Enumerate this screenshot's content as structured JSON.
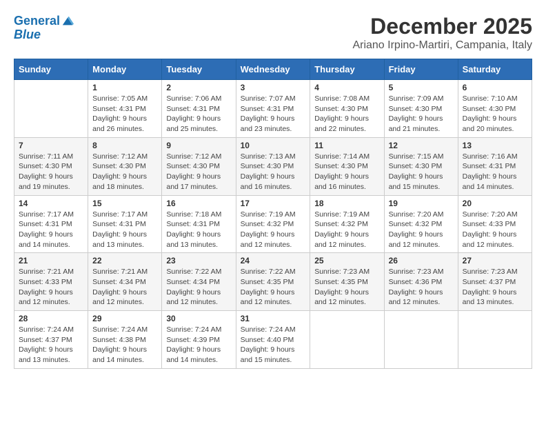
{
  "logo": {
    "line1": "General",
    "line2": "Blue"
  },
  "title": "December 2025",
  "location": "Ariano Irpino-Martiri, Campania, Italy",
  "days_of_week": [
    "Sunday",
    "Monday",
    "Tuesday",
    "Wednesday",
    "Thursday",
    "Friday",
    "Saturday"
  ],
  "weeks": [
    [
      {
        "day": "",
        "text": ""
      },
      {
        "day": "1",
        "text": "Sunrise: 7:05 AM\nSunset: 4:31 PM\nDaylight: 9 hours\nand 26 minutes."
      },
      {
        "day": "2",
        "text": "Sunrise: 7:06 AM\nSunset: 4:31 PM\nDaylight: 9 hours\nand 25 minutes."
      },
      {
        "day": "3",
        "text": "Sunrise: 7:07 AM\nSunset: 4:31 PM\nDaylight: 9 hours\nand 23 minutes."
      },
      {
        "day": "4",
        "text": "Sunrise: 7:08 AM\nSunset: 4:30 PM\nDaylight: 9 hours\nand 22 minutes."
      },
      {
        "day": "5",
        "text": "Sunrise: 7:09 AM\nSunset: 4:30 PM\nDaylight: 9 hours\nand 21 minutes."
      },
      {
        "day": "6",
        "text": "Sunrise: 7:10 AM\nSunset: 4:30 PM\nDaylight: 9 hours\nand 20 minutes."
      }
    ],
    [
      {
        "day": "7",
        "text": "Sunrise: 7:11 AM\nSunset: 4:30 PM\nDaylight: 9 hours\nand 19 minutes."
      },
      {
        "day": "8",
        "text": "Sunrise: 7:12 AM\nSunset: 4:30 PM\nDaylight: 9 hours\nand 18 minutes."
      },
      {
        "day": "9",
        "text": "Sunrise: 7:12 AM\nSunset: 4:30 PM\nDaylight: 9 hours\nand 17 minutes."
      },
      {
        "day": "10",
        "text": "Sunrise: 7:13 AM\nSunset: 4:30 PM\nDaylight: 9 hours\nand 16 minutes."
      },
      {
        "day": "11",
        "text": "Sunrise: 7:14 AM\nSunset: 4:30 PM\nDaylight: 9 hours\nand 16 minutes."
      },
      {
        "day": "12",
        "text": "Sunrise: 7:15 AM\nSunset: 4:30 PM\nDaylight: 9 hours\nand 15 minutes."
      },
      {
        "day": "13",
        "text": "Sunrise: 7:16 AM\nSunset: 4:31 PM\nDaylight: 9 hours\nand 14 minutes."
      }
    ],
    [
      {
        "day": "14",
        "text": "Sunrise: 7:17 AM\nSunset: 4:31 PM\nDaylight: 9 hours\nand 14 minutes."
      },
      {
        "day": "15",
        "text": "Sunrise: 7:17 AM\nSunset: 4:31 PM\nDaylight: 9 hours\nand 13 minutes."
      },
      {
        "day": "16",
        "text": "Sunrise: 7:18 AM\nSunset: 4:31 PM\nDaylight: 9 hours\nand 13 minutes."
      },
      {
        "day": "17",
        "text": "Sunrise: 7:19 AM\nSunset: 4:32 PM\nDaylight: 9 hours\nand 12 minutes."
      },
      {
        "day": "18",
        "text": "Sunrise: 7:19 AM\nSunset: 4:32 PM\nDaylight: 9 hours\nand 12 minutes."
      },
      {
        "day": "19",
        "text": "Sunrise: 7:20 AM\nSunset: 4:32 PM\nDaylight: 9 hours\nand 12 minutes."
      },
      {
        "day": "20",
        "text": "Sunrise: 7:20 AM\nSunset: 4:33 PM\nDaylight: 9 hours\nand 12 minutes."
      }
    ],
    [
      {
        "day": "21",
        "text": "Sunrise: 7:21 AM\nSunset: 4:33 PM\nDaylight: 9 hours\nand 12 minutes."
      },
      {
        "day": "22",
        "text": "Sunrise: 7:21 AM\nSunset: 4:34 PM\nDaylight: 9 hours\nand 12 minutes."
      },
      {
        "day": "23",
        "text": "Sunrise: 7:22 AM\nSunset: 4:34 PM\nDaylight: 9 hours\nand 12 minutes."
      },
      {
        "day": "24",
        "text": "Sunrise: 7:22 AM\nSunset: 4:35 PM\nDaylight: 9 hours\nand 12 minutes."
      },
      {
        "day": "25",
        "text": "Sunrise: 7:23 AM\nSunset: 4:35 PM\nDaylight: 9 hours\nand 12 minutes."
      },
      {
        "day": "26",
        "text": "Sunrise: 7:23 AM\nSunset: 4:36 PM\nDaylight: 9 hours\nand 12 minutes."
      },
      {
        "day": "27",
        "text": "Sunrise: 7:23 AM\nSunset: 4:37 PM\nDaylight: 9 hours\nand 13 minutes."
      }
    ],
    [
      {
        "day": "28",
        "text": "Sunrise: 7:24 AM\nSunset: 4:37 PM\nDaylight: 9 hours\nand 13 minutes."
      },
      {
        "day": "29",
        "text": "Sunrise: 7:24 AM\nSunset: 4:38 PM\nDaylight: 9 hours\nand 14 minutes."
      },
      {
        "day": "30",
        "text": "Sunrise: 7:24 AM\nSunset: 4:39 PM\nDaylight: 9 hours\nand 14 minutes."
      },
      {
        "day": "31",
        "text": "Sunrise: 7:24 AM\nSunset: 4:40 PM\nDaylight: 9 hours\nand 15 minutes."
      },
      {
        "day": "",
        "text": ""
      },
      {
        "day": "",
        "text": ""
      },
      {
        "day": "",
        "text": ""
      }
    ]
  ]
}
